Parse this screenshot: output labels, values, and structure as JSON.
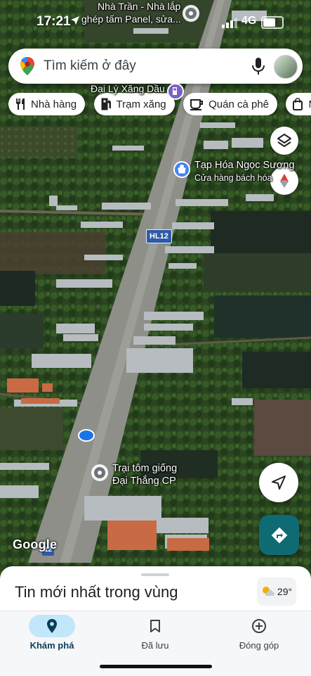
{
  "status_bar": {
    "time": "17:21",
    "network": "4G",
    "battery_level": 0.75
  },
  "search": {
    "placeholder": "Tìm kiếm ở đây"
  },
  "chips": [
    {
      "label": "Nhà hàng",
      "icon": "fork-knife-icon"
    },
    {
      "label": "Trạm xăng",
      "icon": "gas-station-icon"
    },
    {
      "label": "Quán cà phê",
      "icon": "coffee-cup-icon"
    },
    {
      "label": "Mu",
      "icon": "shopping-bag-icon"
    }
  ],
  "map": {
    "labels": {
      "top_place_line1": "Nhà Trần - Nhà lắp",
      "top_place_line2": "ghép tấm Panel, sửa...",
      "gas_station": "Đại Lý Xăng Dầu",
      "store_name": "Tạp Hóa Ngọc Sương",
      "store_category": "Cửa hàng bách hóa",
      "road_shield": "HL12",
      "road_shield_bottom": "12",
      "farm_line1": "Trại tôm giống",
      "farm_line2": "Đại Thắng CP"
    },
    "attribution": "Google",
    "colors": {
      "road": "#8d8f88",
      "water": "#1d2a22",
      "vegetation": "#27401f"
    }
  },
  "bottom_sheet": {
    "title": "Tin mới nhất trong vùng",
    "weather": {
      "temperature": "29°",
      "icon": "partly-cloudy-icon"
    }
  },
  "nav": [
    {
      "label": "Khám phá",
      "icon": "explore-pin-icon",
      "active": true
    },
    {
      "label": "Đã lưu",
      "icon": "bookmark-icon",
      "active": false
    },
    {
      "label": "Đóng góp",
      "icon": "add-circle-icon",
      "active": false
    }
  ]
}
